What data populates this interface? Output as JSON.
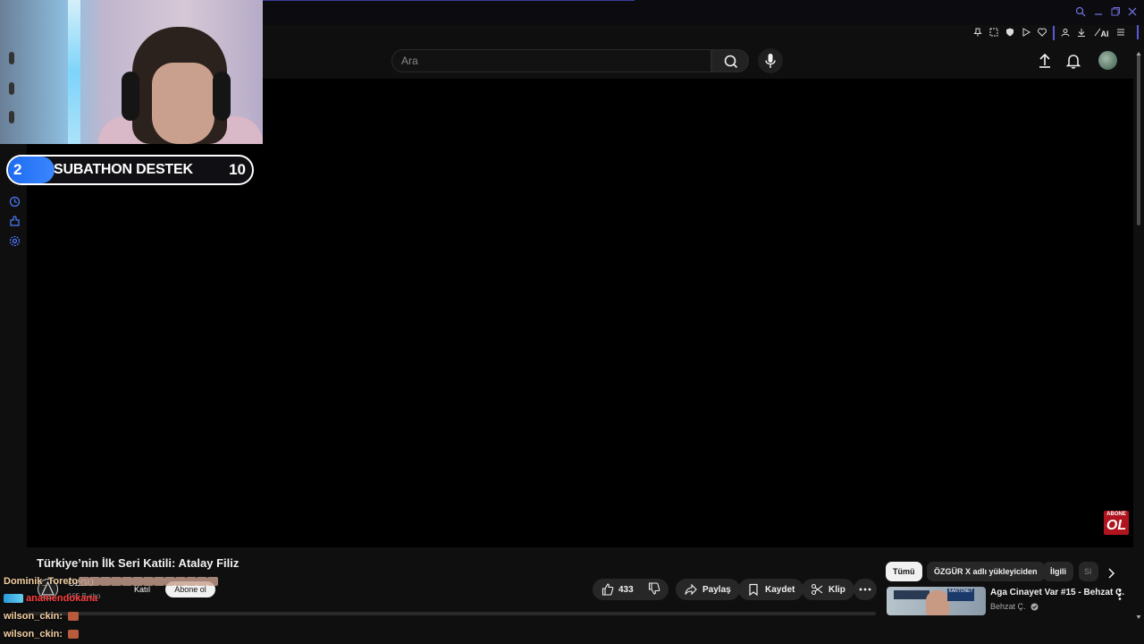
{
  "overlay": {
    "subathon": {
      "left_value": "2",
      "title": "SUBATHON DESTEK",
      "right_value": "10",
      "progress_fraction": 0.2
    },
    "chat": [
      {
        "user": "Dominik_Toreto_",
        "text": ""
      },
      {
        "user": "anamendokana",
        "text": ""
      },
      {
        "user": "wilson_ckin:",
        "text": ""
      },
      {
        "user": "wilson_ckin:",
        "text": ""
      }
    ]
  },
  "header": {
    "search_placeholder": "Ara",
    "ai_label": "AI"
  },
  "video": {
    "title": "Türkiye’nin İlk Seri Katili: Atalay Filiz",
    "channel_name": "ÖZGÜ",
    "channel_subs": "165 B abo",
    "join_label": "Katıl",
    "subscribe_label": "Abone ol",
    "likes": "433",
    "share_label": "Paylaş",
    "save_label": "Kaydet",
    "clip_label": "Klip",
    "badge_top": "ABONE",
    "badge_bottom": "OL"
  },
  "chips": {
    "all": "Tümü",
    "uploader": "ÖZGÜR X adlı yükleyiciden",
    "related": "İlgili",
    "cut": "Si"
  },
  "related": {
    "title": "Aga Cinayet Var #15 - Behzat Ç.",
    "channel": "Behzat Ç.",
    "thumb_tag": "KARTONET"
  },
  "colors": {
    "accent_blue": "#3b86ff",
    "badge_red": "#b0141e",
    "chat_user": "#f4cfa0"
  }
}
